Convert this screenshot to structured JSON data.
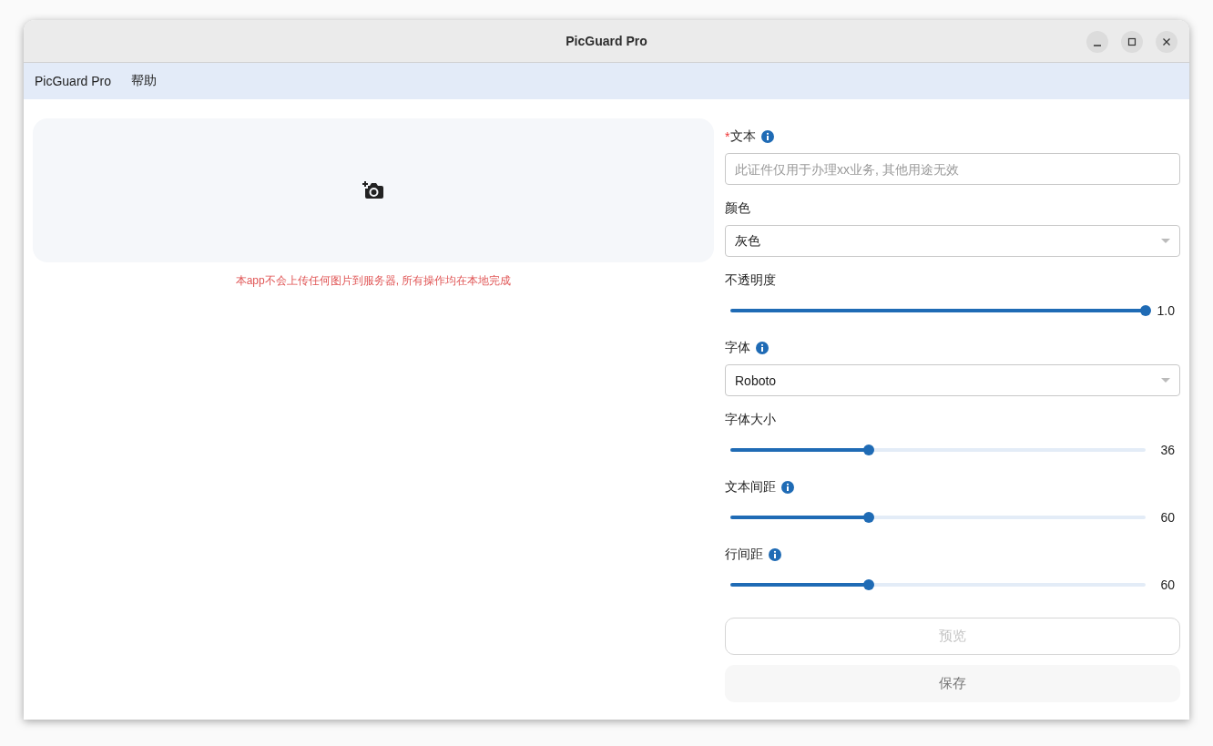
{
  "window": {
    "title": "PicGuard Pro"
  },
  "menu": [
    "PicGuard Pro",
    "帮助"
  ],
  "upload": {
    "notice": "本app不会上传任何图片到服务器, 所有操作均在本地完成"
  },
  "fields": [
    {
      "kind": "text",
      "required_mark": "*",
      "label": "文本",
      "info": true,
      "placeholder": "此证件仅用于办理xx业务, 其他用途无效"
    },
    {
      "kind": "select",
      "label": "颜色",
      "info": false,
      "value": "灰色"
    },
    {
      "kind": "slider",
      "label": "不透明度",
      "info": false,
      "level": 1.0,
      "reading": "1.0"
    },
    {
      "kind": "select",
      "label": "字体",
      "info": true,
      "value": "Roboto"
    },
    {
      "kind": "slider",
      "label": "字体大小",
      "info": false,
      "level": 0.333,
      "reading": "36"
    },
    {
      "kind": "slider",
      "label": "文本间距",
      "info": true,
      "level": 0.333,
      "reading": "60"
    },
    {
      "kind": "slider",
      "label": "行间距",
      "info": true,
      "level": 0.333,
      "reading": "60"
    }
  ],
  "buttons": [
    {
      "kind": "outlined",
      "label": "预览",
      "disabled": true
    },
    {
      "kind": "filled",
      "label": "保存",
      "disabled": false
    }
  ]
}
